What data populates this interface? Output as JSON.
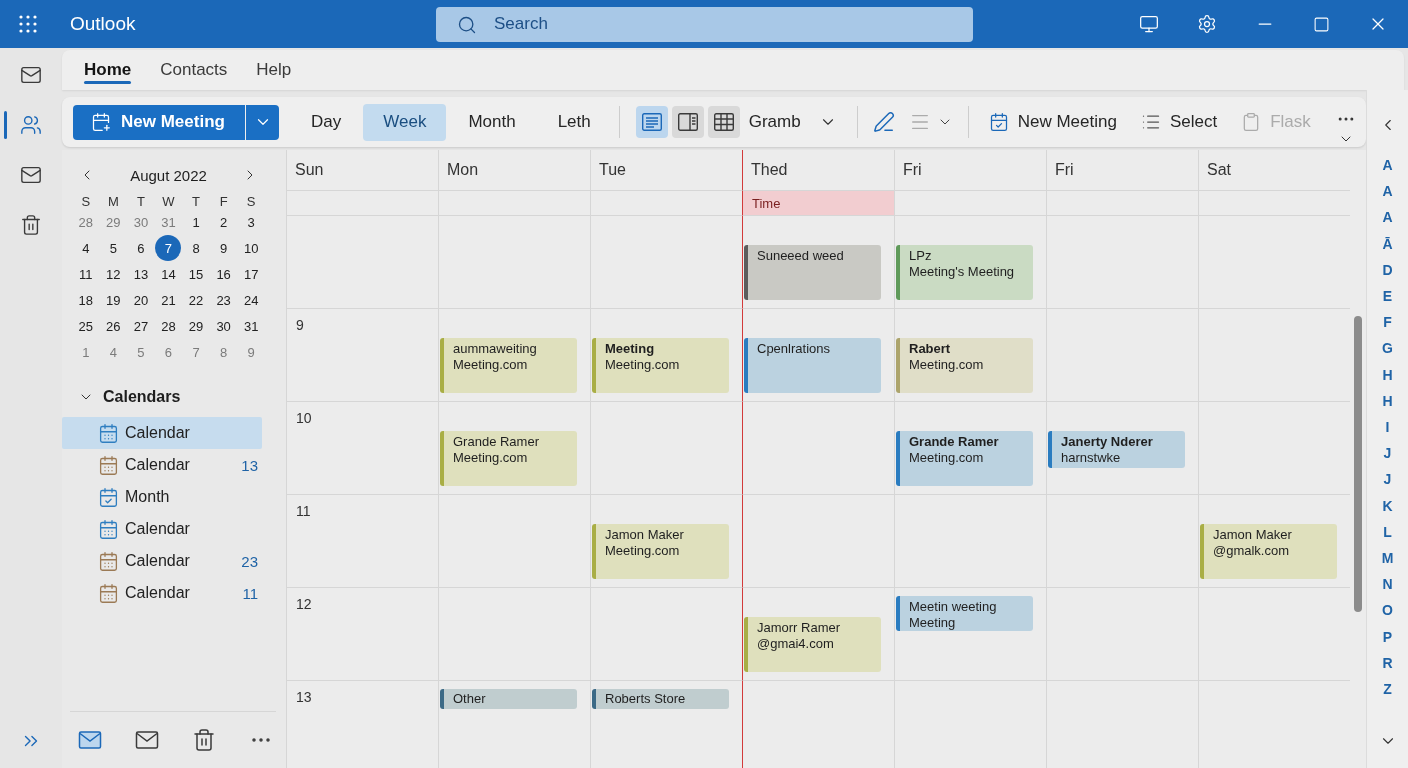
{
  "app": {
    "title": "Outlook"
  },
  "search": {
    "placeholder": "Search"
  },
  "nav_rail": {
    "items": [
      {
        "kind": "mail",
        "selected": false
      },
      {
        "kind": "people",
        "selected": true
      },
      {
        "kind": "mail",
        "selected": false
      },
      {
        "kind": "trash",
        "selected": false
      }
    ]
  },
  "tabs": [
    {
      "label": "Home",
      "selected": true
    },
    {
      "label": "Contacts",
      "selected": false
    },
    {
      "label": "Help",
      "selected": false
    }
  ],
  "ribbon": {
    "new_meeting": {
      "label": "New Meeting"
    },
    "views": [
      {
        "label": "Day",
        "selected": false
      },
      {
        "label": "Week",
        "selected": true
      },
      {
        "label": "Month",
        "selected": false
      },
      {
        "label": "Leth",
        "selected": false
      }
    ],
    "layouts": [
      {
        "kind": "lines",
        "selected": true
      },
      {
        "kind": "panel",
        "selected": false
      },
      {
        "kind": "table",
        "selected": false
      }
    ],
    "layout_menu": {
      "label": "Gramb"
    },
    "format_tools": [
      {
        "kind": "pen",
        "disabled": false,
        "dropdown": false
      },
      {
        "kind": "lines",
        "disabled": true,
        "dropdown": true
      }
    ],
    "actions": [
      {
        "kind": "calendar",
        "label": "New Meeting",
        "disabled": false
      },
      {
        "kind": "list",
        "label": "Select",
        "disabled": false
      },
      {
        "kind": "clipboard",
        "label": "Flask",
        "disabled": true
      }
    ]
  },
  "mini_calendar": {
    "title": "Augut 2022",
    "weekdays": [
      "S",
      "M",
      "T",
      "W",
      "T",
      "F",
      "S"
    ],
    "weeks": [
      {
        "days": [
          {
            "text": "28",
            "outside": true,
            "selected": false
          },
          {
            "text": "29",
            "outside": true,
            "selected": false
          },
          {
            "text": "30",
            "outside": true,
            "selected": false
          },
          {
            "text": "31",
            "outside": true,
            "selected": false
          },
          {
            "text": "1",
            "outside": false,
            "selected": false
          },
          {
            "text": "2",
            "outside": false,
            "selected": false
          },
          {
            "text": "3",
            "outside": false,
            "selected": false
          }
        ]
      },
      {
        "days": [
          {
            "text": "4",
            "outside": false,
            "selected": false
          },
          {
            "text": "5",
            "outside": false,
            "selected": false
          },
          {
            "text": "6",
            "outside": false,
            "selected": false
          },
          {
            "text": "7",
            "outside": false,
            "selected": true
          },
          {
            "text": "8",
            "outside": false,
            "selected": false
          },
          {
            "text": "9",
            "outside": false,
            "selected": false
          },
          {
            "text": "10",
            "outside": false,
            "selected": false
          }
        ]
      },
      {
        "days": [
          {
            "text": "11",
            "outside": false,
            "selected": false
          },
          {
            "text": "12",
            "outside": false,
            "selected": false
          },
          {
            "text": "13",
            "outside": false,
            "selected": false
          },
          {
            "text": "14",
            "outside": false,
            "selected": false
          },
          {
            "text": "15",
            "outside": false,
            "selected": false
          },
          {
            "text": "16",
            "outside": false,
            "selected": false
          },
          {
            "text": "17",
            "outside": false,
            "selected": false
          }
        ]
      },
      {
        "days": [
          {
            "text": "18",
            "outside": false,
            "selected": false
          },
          {
            "text": "19",
            "outside": false,
            "selected": false
          },
          {
            "text": "20",
            "outside": false,
            "selected": false
          },
          {
            "text": "21",
            "outside": false,
            "selected": false
          },
          {
            "text": "22",
            "outside": false,
            "selected": false
          },
          {
            "text": "23",
            "outside": false,
            "selected": false
          },
          {
            "text": "24",
            "outside": false,
            "selected": false
          }
        ]
      },
      {
        "days": [
          {
            "text": "25",
            "outside": false,
            "selected": false
          },
          {
            "text": "26",
            "outside": false,
            "selected": false
          },
          {
            "text": "27",
            "outside": false,
            "selected": false
          },
          {
            "text": "28",
            "outside": false,
            "selected": false
          },
          {
            "text": "29",
            "outside": false,
            "selected": false
          },
          {
            "text": "30",
            "outside": false,
            "selected": false
          },
          {
            "text": "31",
            "outside": false,
            "selected": false
          }
        ]
      },
      {
        "days": [
          {
            "text": "1",
            "outside": true,
            "selected": false
          },
          {
            "text": "4",
            "outside": true,
            "selected": false
          },
          {
            "text": "5",
            "outside": true,
            "selected": false
          },
          {
            "text": "6",
            "outside": true,
            "selected": false
          },
          {
            "text": "7",
            "outside": true,
            "selected": false
          },
          {
            "text": "8",
            "outside": true,
            "selected": false
          },
          {
            "text": "9",
            "outside": true,
            "selected": false
          }
        ]
      }
    ]
  },
  "calendars": {
    "heading": "Calendars",
    "expanded": true,
    "items": [
      {
        "label": "Calendar",
        "kind": "grid",
        "color": "#2f7ec0",
        "selected": true
      },
      {
        "label": "Calendar",
        "kind": "grid",
        "color": "#9b7a55",
        "count": "13",
        "selected": false
      },
      {
        "label": "Month",
        "kind": "check",
        "color": "#2f7ec0",
        "selected": false
      },
      {
        "label": "Calendar",
        "kind": "grid",
        "color": "#2f7ec0",
        "selected": false
      },
      {
        "label": "Calendar",
        "kind": "grid",
        "color": "#9b7a55",
        "count": "23",
        "selected": false
      },
      {
        "label": "Calendar",
        "kind": "grid",
        "color": "#9b7a55",
        "count": "11",
        "selected": false
      }
    ]
  },
  "pane_footer": [
    {
      "kind": "mail",
      "selected": true
    },
    {
      "kind": "mail",
      "selected": false
    },
    {
      "kind": "trash",
      "selected": false
    },
    {
      "kind": "more",
      "selected": false
    }
  ],
  "week": {
    "days": [
      {
        "label": "Sun",
        "today": false
      },
      {
        "label": "Mon",
        "today": false
      },
      {
        "label": "Tue",
        "today": false
      },
      {
        "label": "Thed",
        "today": true
      },
      {
        "label": "Fri",
        "today": false
      },
      {
        "label": "Fri",
        "today": false
      },
      {
        "label": "Sat",
        "today": false
      }
    ],
    "all_day": {
      "cells": [
        {},
        {},
        {},
        {
          "events": [
            {
              "title": "Time",
              "color": "#f2cdd0"
            }
          ]
        },
        {},
        {},
        {}
      ]
    },
    "hours": [
      {
        "cells": [
          {},
          {},
          {},
          {
            "events": [
              {
                "kind": "full",
                "title": "Suneeed weed",
                "bold": false,
                "color": "#5c5c5c"
              }
            ]
          },
          {
            "events": [
              {
                "kind": "full",
                "title": "LPz",
                "detail": "Meeting's Meeting",
                "bold": false,
                "color": "#5f9a5a"
              }
            ]
          },
          {},
          {}
        ]
      },
      {
        "label": "9",
        "cells": [
          {},
          {
            "events": [
              {
                "kind": "full",
                "title": "aummaweiting",
                "detail": "Meeting.com",
                "bold": false,
                "color": "#a9ae45"
              }
            ]
          },
          {
            "events": [
              {
                "kind": "full",
                "title": "Meeting",
                "detail": "Meeting.com",
                "bold": true,
                "color": "#a9ae45"
              }
            ]
          },
          {
            "events": [
              {
                "kind": "full",
                "title": "Cpenlrations",
                "bold": false,
                "color": "#2a7cc0"
              }
            ]
          },
          {
            "events": [
              {
                "kind": "full",
                "title": "Rabert",
                "detail": "Meeting.com",
                "bold": true,
                "color": "#aca46c"
              }
            ]
          },
          {},
          {}
        ]
      },
      {
        "label": "10",
        "cells": [
          {},
          {
            "events": [
              {
                "kind": "full",
                "title": "Grande Ramer",
                "detail": "Meeting.com",
                "bold": false,
                "color": "#a9ae45"
              }
            ]
          },
          {},
          {},
          {
            "events": [
              {
                "kind": "full",
                "title": "Grande Ramer",
                "detail": "Meeting.com",
                "bold": true,
                "color": "#2a7cc0"
              }
            ]
          },
          {
            "events": [
              {
                "kind": "compact",
                "title": "Janerty Nderer",
                "detail": "harnstwke",
                "bold": true,
                "color": "#2a7cc0"
              }
            ]
          },
          {}
        ]
      },
      {
        "label": "11",
        "cells": [
          {},
          {},
          {
            "events": [
              {
                "kind": "full",
                "title": "Jamon Maker",
                "detail": "Meeting.com",
                "bold": false,
                "color": "#a9ae45"
              }
            ]
          },
          {},
          {},
          {},
          {
            "events": [
              {
                "kind": "full",
                "title": "Jamon Maker",
                "detail": "@gmalk.com",
                "bold": false,
                "color": "#a9ae45"
              }
            ]
          }
        ]
      },
      {
        "label": "12",
        "cells": [
          {},
          {},
          {},
          {
            "events": [
              {
                "kind": "full",
                "title": "Jamorr Ramer",
                "detail": "@gmai4.com",
                "bold": false,
                "color": "#a9ae45"
              }
            ]
          },
          {
            "events": [
              {
                "kind": "top",
                "title": "Meetin weeting",
                "detail": "Meeting",
                "bold": false,
                "color": "#2a7cc0"
              }
            ]
          },
          {},
          {}
        ]
      },
      {
        "label": "13",
        "cells": [
          {},
          {
            "events": [
              {
                "kind": "bar",
                "title": "Other",
                "bold": false,
                "color": "#3c6a86"
              }
            ]
          },
          {
            "events": [
              {
                "kind": "bar",
                "title": "Roberts Store",
                "bold": false,
                "color": "#3c6a86"
              }
            ]
          },
          {},
          {},
          {},
          {}
        ]
      }
    ]
  },
  "index_rail": {
    "letters": [
      "A",
      "A",
      "A",
      "Ā",
      "D",
      "E",
      "F",
      "G",
      "H",
      "H",
      "I",
      "J",
      "J",
      "K",
      "L",
      "M",
      "N",
      "O",
      "P",
      "R",
      "Z"
    ]
  }
}
